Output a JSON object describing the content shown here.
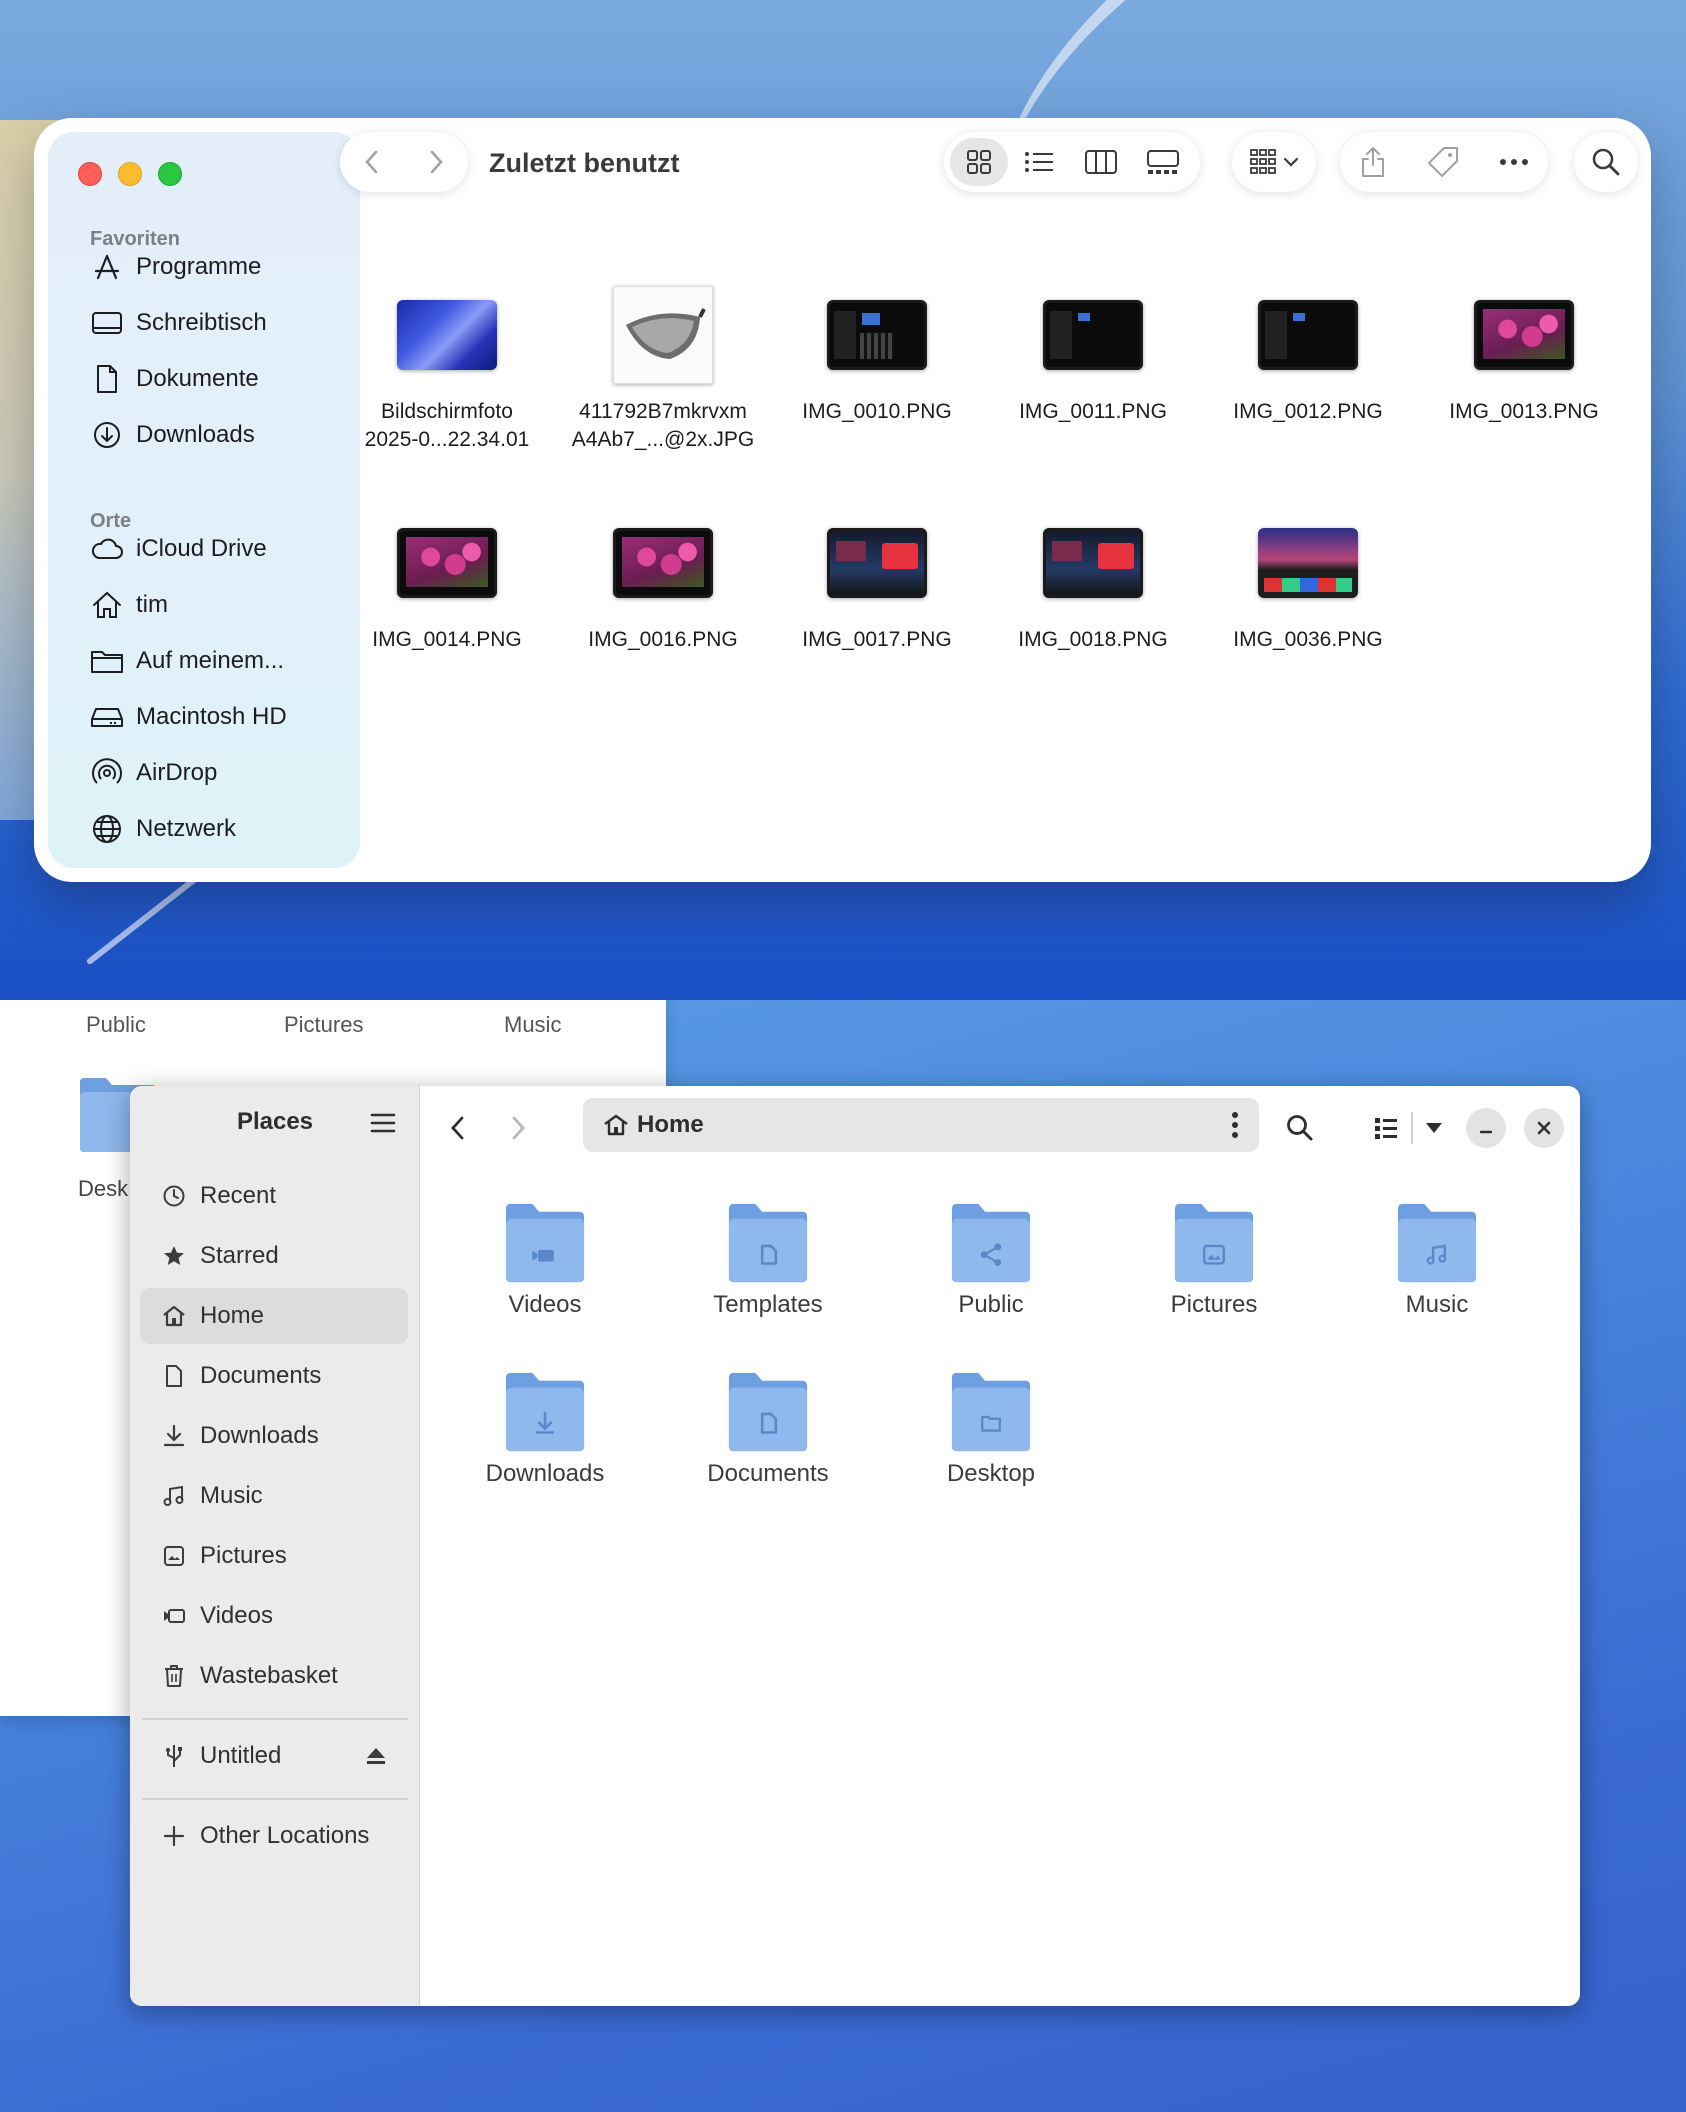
{
  "finder": {
    "title": "Zuletzt benutzt",
    "sidebar": {
      "favorites_heading": "Favoriten",
      "favorites": [
        {
          "label": "Programme",
          "icon": "apps-icon"
        },
        {
          "label": "Schreibtisch",
          "icon": "desktop-icon"
        },
        {
          "label": "Dokumente",
          "icon": "document-icon"
        },
        {
          "label": "Downloads",
          "icon": "download-icon"
        }
      ],
      "locations_heading": "Orte",
      "locations": [
        {
          "label": "iCloud Drive",
          "icon": "cloud-icon"
        },
        {
          "label": "tim",
          "icon": "home-icon"
        },
        {
          "label": "Auf meinem...",
          "icon": "folder-icon"
        },
        {
          "label": "Macintosh HD",
          "icon": "drive-icon"
        },
        {
          "label": "AirDrop",
          "icon": "airdrop-icon"
        },
        {
          "label": "Netzwerk",
          "icon": "network-icon"
        }
      ]
    },
    "files": [
      {
        "name": "Bildschirmfoto\n2025-0...22.34.01",
        "thumb": "wallpaper"
      },
      {
        "name": "411792B7mkrvxm\nA4Ab7_...@2x.JPG",
        "thumb": "golf-driver"
      },
      {
        "name": "IMG_0010.PNG",
        "thumb": "dark-screen"
      },
      {
        "name": "IMG_0011.PNG",
        "thumb": "dark-screen"
      },
      {
        "name": "IMG_0012.PNG",
        "thumb": "dark-screen"
      },
      {
        "name": "IMG_0013.PNG",
        "thumb": "flowers"
      },
      {
        "name": "IMG_0014.PNG",
        "thumb": "flowers"
      },
      {
        "name": "IMG_0016.PNG",
        "thumb": "flowers"
      },
      {
        "name": "IMG_0017.PNG",
        "thumb": "music-app"
      },
      {
        "name": "IMG_0018.PNG",
        "thumb": "music-app"
      },
      {
        "name": "IMG_0036.PNG",
        "thumb": "web-page"
      }
    ],
    "colors": {
      "close": "#fe5f57",
      "minimize": "#febc2e",
      "zoom": "#28c840"
    }
  },
  "bg_window": {
    "tabs": [
      "Public",
      "Pictures",
      "Music"
    ],
    "folder_label": "Desk"
  },
  "nautilus": {
    "sidebar_title": "Places",
    "path_label": "Home",
    "places": [
      {
        "label": "Recent",
        "icon": "clock-icon"
      },
      {
        "label": "Starred",
        "icon": "star-icon"
      },
      {
        "label": "Home",
        "icon": "home-icon",
        "active": true
      },
      {
        "label": "Documents",
        "icon": "document-icon"
      },
      {
        "label": "Downloads",
        "icon": "download-icon"
      },
      {
        "label": "Music",
        "icon": "music-icon"
      },
      {
        "label": "Pictures",
        "icon": "picture-icon"
      },
      {
        "label": "Videos",
        "icon": "video-icon"
      },
      {
        "label": "Wastebasket",
        "icon": "trash-icon"
      }
    ],
    "devices": [
      {
        "label": "Untitled",
        "icon": "usb-icon"
      }
    ],
    "other_locations": "Other Locations",
    "folders": [
      {
        "label": "Videos",
        "icon": "video-icon"
      },
      {
        "label": "Templates",
        "icon": "template-icon"
      },
      {
        "label": "Public",
        "icon": "share-icon"
      },
      {
        "label": "Pictures",
        "icon": "picture-icon"
      },
      {
        "label": "Music",
        "icon": "music-icon"
      },
      {
        "label": "Downloads",
        "icon": "download-icon"
      },
      {
        "label": "Documents",
        "icon": "document-icon"
      },
      {
        "label": "Desktop",
        "icon": "folder-icon"
      }
    ],
    "colors": {
      "folder": "#8fb8ec",
      "folder_dark": "#6e9fe0",
      "folder_glyph": "#5b86c9"
    }
  }
}
